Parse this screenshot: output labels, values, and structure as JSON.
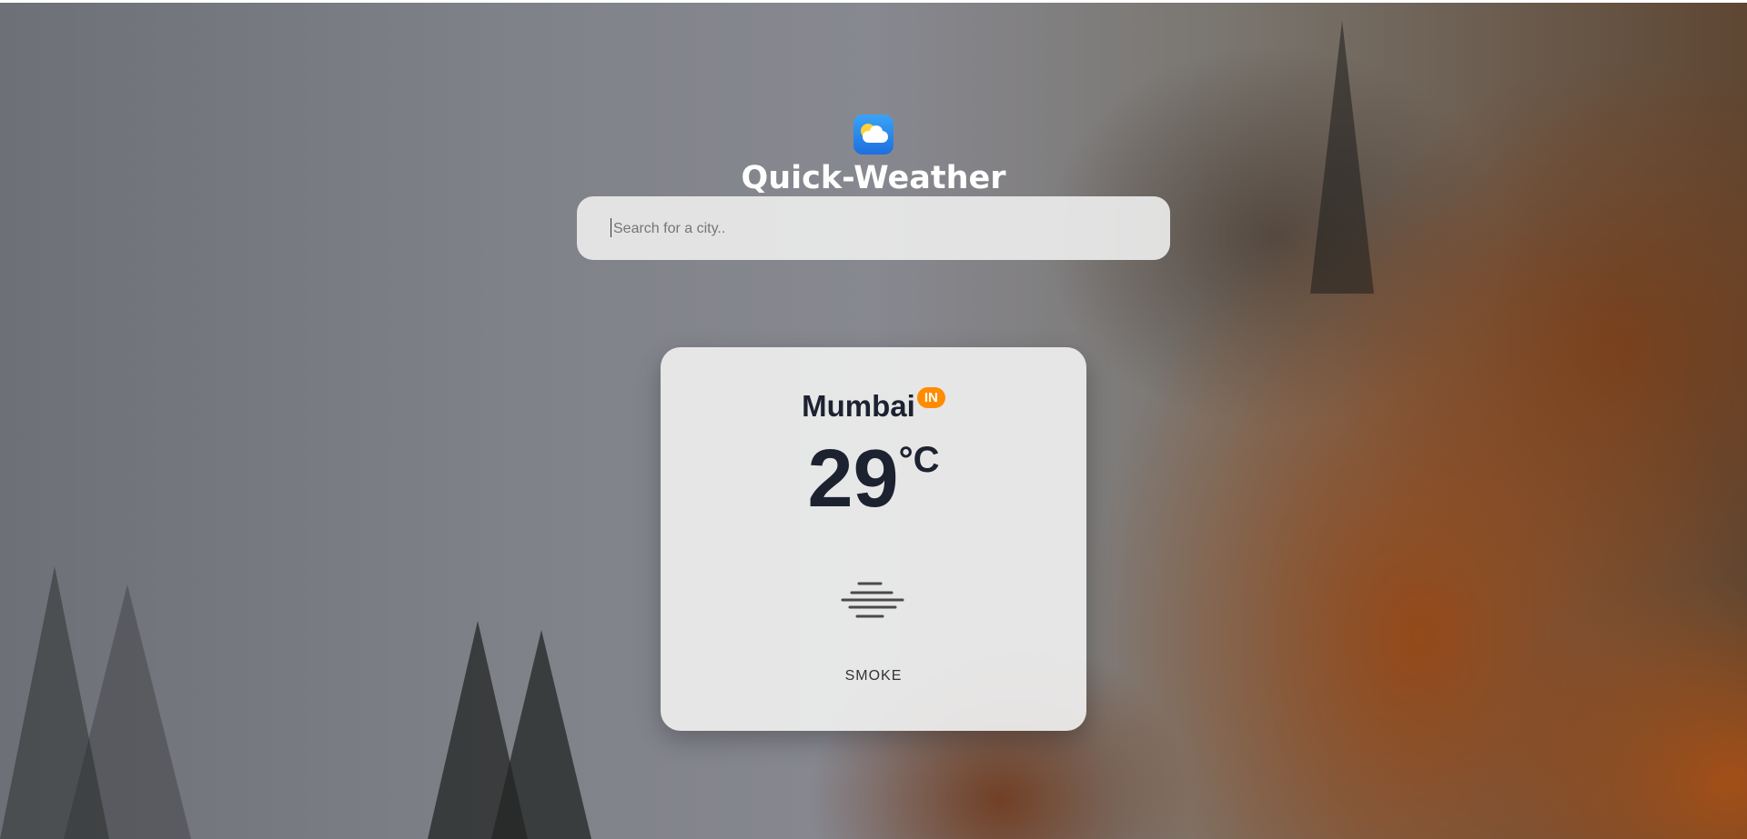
{
  "app": {
    "title": "Quick-Weather",
    "logo_icon": "sun-behind-cloud-icon"
  },
  "search": {
    "placeholder": "Search for a city..",
    "value": ""
  },
  "weather_card": {
    "city": "Mumbai",
    "country_code": "IN",
    "temperature": "29",
    "unit": "°C",
    "condition_icon": "smoke-icon",
    "description": "SMOKE"
  },
  "colors": {
    "country_badge": "#ff8c00",
    "text_dark": "#1d2230",
    "title_text": "#ffffff"
  }
}
